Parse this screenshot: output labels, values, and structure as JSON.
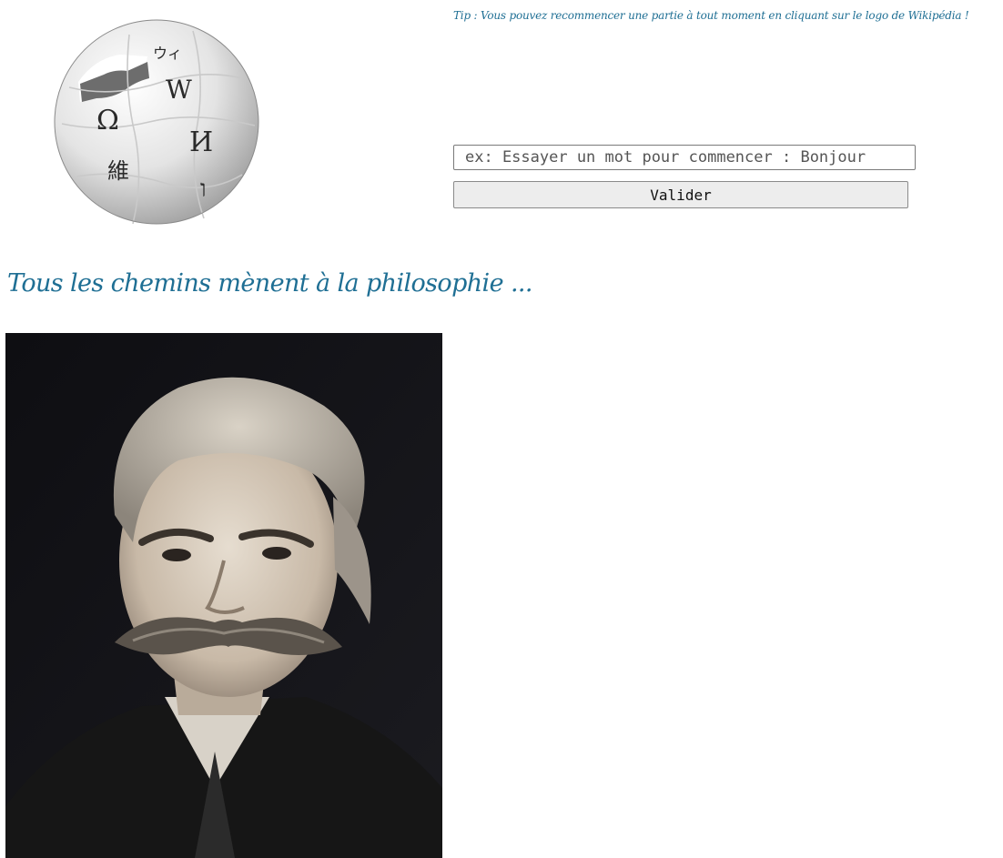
{
  "logo": {
    "glyphs": [
      "Ω",
      "W",
      "И",
      "維",
      "ウィ",
      "ו"
    ]
  },
  "tip": {
    "text": "Tip : Vous pouvez recommencer une partie à tout moment en cliquant sur le logo de Wikipédia !"
  },
  "search": {
    "placeholder": "ex: Essayer un mot pour commencer : Bonjour",
    "value": ""
  },
  "submit": {
    "label": "Valider"
  },
  "headline": {
    "text": "Tous les chemins mènent à la philosophie ..."
  },
  "colors": {
    "accent_text": "#1f6f94"
  }
}
